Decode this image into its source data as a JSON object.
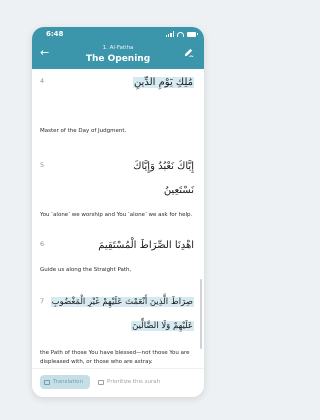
{
  "status": {
    "time": "6:48"
  },
  "header": {
    "subtitle": "1. Al-Fatiha",
    "title": "The Opening"
  },
  "verses": [
    {
      "num": "4",
      "arabic": [
        "مَٰلِكِ يَوْمِ الدِّينِ"
      ],
      "translation": "Master of the Day of Judgment."
    },
    {
      "num": "5",
      "arabic": [
        "إِيَّاكَ نَعْبُدُ وَإِيَّاكَ",
        "نَسْتَعِينُ"
      ],
      "translation": "You ˹alone˺ we worship and You ˹alone˺ we ask for help."
    },
    {
      "num": "6",
      "arabic": [
        "اهْدِنَا الصِّرَاطَ الْمُسْتَقِيمَ"
      ],
      "translation": "Guide us along the Straight Path,"
    },
    {
      "num": "7",
      "arabic": [
        "صِرَاطَ الَّذِينَ أَنْعَمْتَ عَلَيْهِمْ غَيْرِ الْمَغْضُوبِ",
        "عَلَيْهِمْ وَلَا الضَّالِّينَ"
      ],
      "translation": "the Path of those You have blessed—not those You are displeased with, or those who are astray."
    }
  ],
  "bottom": {
    "translation_label": "Translation",
    "prioritize_label": "Prioritize this surah"
  },
  "colors": {
    "header": "#3c96ab",
    "highlight": "#d6eaf2"
  }
}
